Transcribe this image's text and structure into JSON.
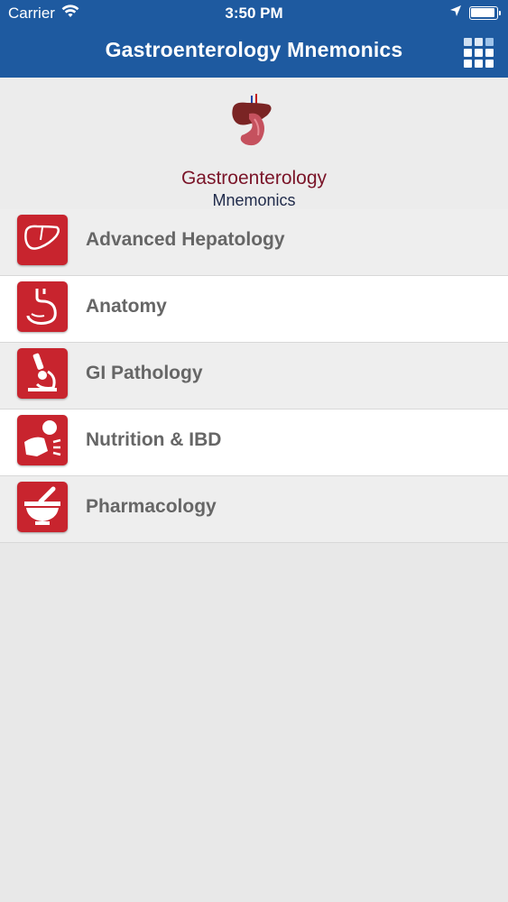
{
  "status_bar": {
    "carrier": "Carrier",
    "time": "3:50 PM"
  },
  "header": {
    "title": "Gastroenterology Mnemonics",
    "menu_icon": "grid-icon",
    "background_color": "#1e5aa0"
  },
  "logo": {
    "line1": "Gastroenterology",
    "line2": "Mnemonics"
  },
  "menu": {
    "items": [
      {
        "label": "Advanced Hepatology",
        "icon": "liver-icon"
      },
      {
        "label": "Anatomy",
        "icon": "stomach-icon"
      },
      {
        "label": "GI Pathology",
        "icon": "microscope-icon"
      },
      {
        "label": "Nutrition & IBD",
        "icon": "abdominal-pain-icon"
      },
      {
        "label": "Pharmacology",
        "icon": "mortar-pestle-icon"
      }
    ],
    "icon_color": "#c8242e",
    "label_color": "#666666"
  }
}
